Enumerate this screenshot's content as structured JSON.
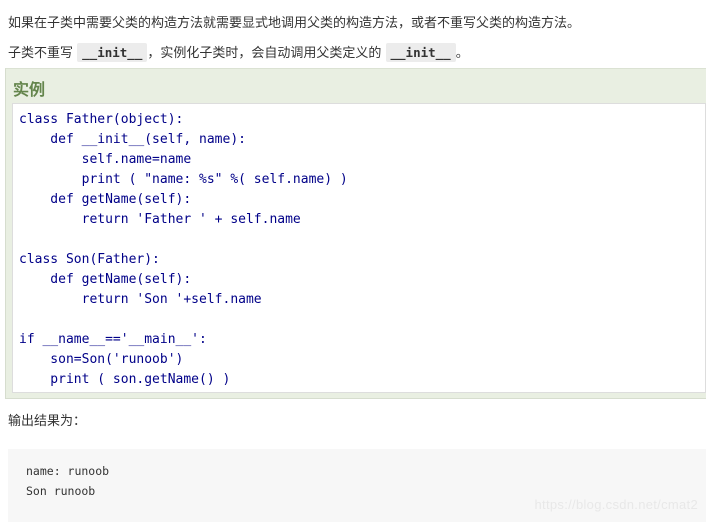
{
  "intro": {
    "line1": "如果在子类中需要父类的构造方法就需要显式地调用父类的构造方法，或者不重写父类的构造方法。",
    "line2_before": "子类不重写 ",
    "line2_code1": "__init__",
    "line2_middle": "，实例化子类时，会自动调用父类定义的 ",
    "line2_code2": "__init__",
    "line2_after": "。"
  },
  "example": {
    "title": "实例",
    "code_lines": [
      "class Father(object):",
      "    def __init__(self, name):",
      "        self.name=name",
      "        print ( \"name: %s\" %( self.name) )",
      "    def getName(self):",
      "        return 'Father ' + self.name",
      "",
      "class Son(Father):",
      "    def getName(self):",
      "        return 'Son '+self.name",
      "",
      "if __name__=='__main__':",
      "    son=Son('runoob')",
      "    print ( son.getName() )"
    ]
  },
  "output": {
    "label": "输出结果为：",
    "lines": [
      "name: runoob",
      "Son runoob"
    ]
  },
  "watermark": "https://blog.csdn.net/cmat2"
}
